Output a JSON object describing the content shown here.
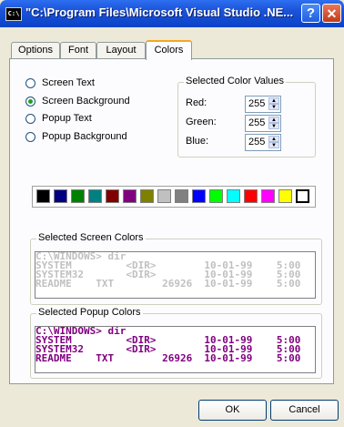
{
  "window": {
    "title": "\"C:\\Program Files\\Microsoft Visual Studio .NE...",
    "icon_label": "C:\\"
  },
  "tabs": [
    {
      "label": "Options"
    },
    {
      "label": "Font"
    },
    {
      "label": "Layout"
    },
    {
      "label": "Colors",
      "active": true
    }
  ],
  "radio_options": [
    {
      "label": "Screen Text",
      "checked": false
    },
    {
      "label": "Screen Background",
      "checked": true
    },
    {
      "label": "Popup Text",
      "checked": false
    },
    {
      "label": "Popup Background",
      "checked": false
    }
  ],
  "color_values": {
    "title": "Selected Color Values",
    "red_label": "Red:",
    "red_value": "255",
    "green_label": "Green:",
    "green_value": "255",
    "blue_label": "Blue:",
    "blue_value": "255"
  },
  "palette": [
    "#000000",
    "#000080",
    "#008000",
    "#008080",
    "#800000",
    "#800080",
    "#808000",
    "#c0c0c0",
    "#808080",
    "#0000ff",
    "#00ff00",
    "#00ffff",
    "#ff0000",
    "#ff00ff",
    "#ffff00",
    "#ffffff"
  ],
  "screen_colors": {
    "title": "Selected Screen Colors",
    "text_color": "#c0c0c0",
    "bg_color": "#ffffff",
    "lines": [
      "C:\\WINDOWS> dir",
      "SYSTEM         <DIR>        10-01-99    5:00",
      "SYSTEM32       <DIR>        10-01-99    5:00",
      "README    TXT        26926  10-01-99    5:00"
    ]
  },
  "popup_colors": {
    "title": "Selected Popup Colors",
    "text_color": "#800080",
    "bg_color": "#ffffff",
    "lines": [
      "C:\\WINDOWS> dir",
      "SYSTEM         <DIR>        10-01-99    5:00",
      "SYSTEM32       <DIR>        10-01-99    5:00",
      "README    TXT        26926  10-01-99    5:00"
    ]
  },
  "buttons": {
    "ok": "OK",
    "cancel": "Cancel"
  }
}
